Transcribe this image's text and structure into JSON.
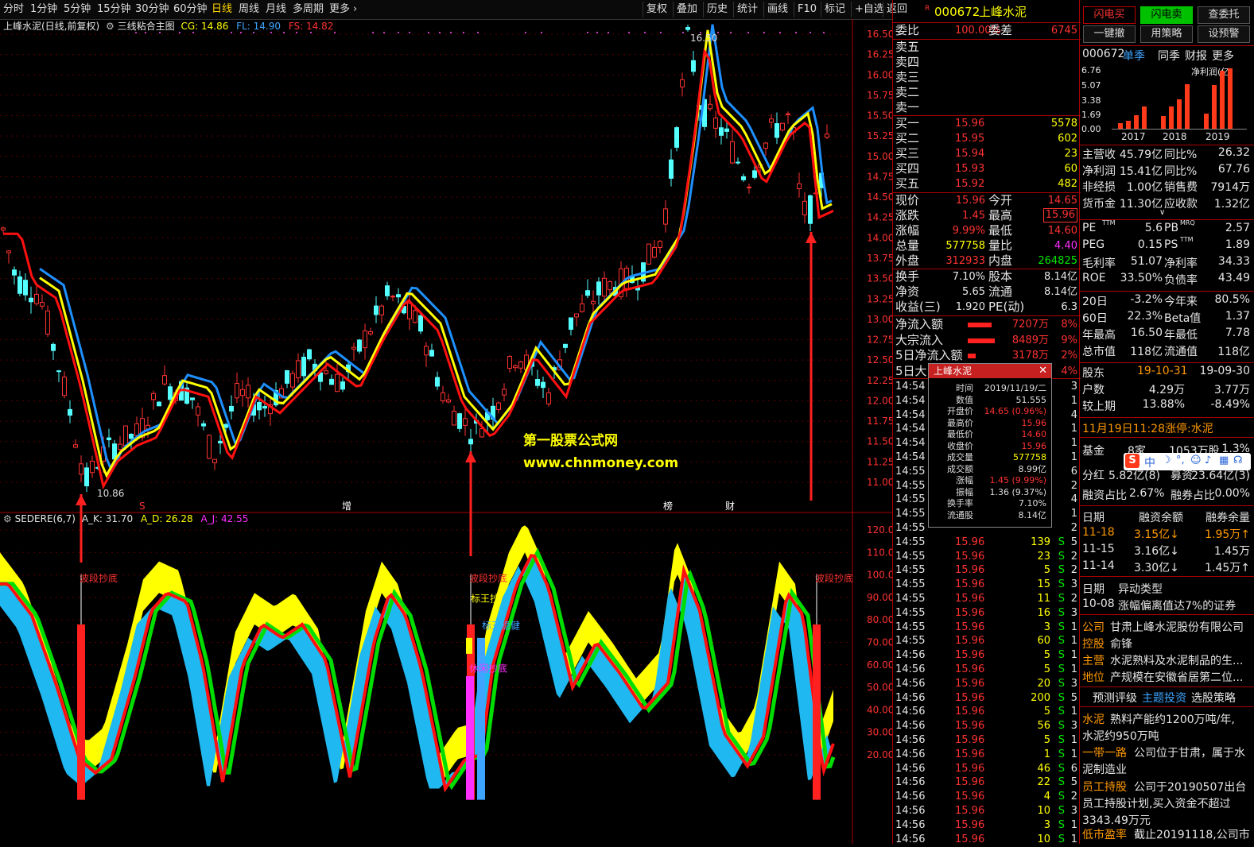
{
  "toolbar": {
    "periods": [
      "分时",
      "1分钟",
      "5分钟",
      "15分钟",
      "30分钟",
      "60分钟",
      "日线",
      "周线",
      "月线",
      "多周期",
      "更多"
    ],
    "active_period": "日线",
    "right_buttons": [
      "复权",
      "叠加",
      "历史",
      "统计",
      "画线",
      "F10",
      "标记",
      "+自选",
      "返回"
    ]
  },
  "main_legend": {
    "stock": "上峰水泥(日线,前复权)",
    "indicator": "三线粘合主图",
    "cg": "CG: 14.86",
    "fl": "FL: 14.90",
    "fs": "FS: 14.82"
  },
  "price_axis": [
    "16.50",
    "16.25",
    "16.00",
    "15.75",
    "15.50",
    "15.25",
    "15.00",
    "14.75",
    "14.50",
    "14.25",
    "14.00",
    "13.75",
    "13.50",
    "13.25",
    "13.00",
    "12.75",
    "12.50",
    "12.25",
    "12.00",
    "11.75",
    "11.50",
    "11.25",
    "11.00"
  ],
  "price_marks": {
    "high": "16.50",
    "low": "10.86"
  },
  "event_marks": [
    "S",
    "增",
    "榜",
    "财"
  ],
  "watermark": {
    "line1": "第一股票公式网",
    "line2": "www.chnmoney.com"
  },
  "sub_legend": {
    "name": "SEDERE(6,7)",
    "k": "A_K: 31.70",
    "d": "A_D: 26.28",
    "j": "A_J: 42.55"
  },
  "sub_axis": [
    "120.0",
    "110.0",
    "100.0",
    "90.00",
    "80.00",
    "70.00",
    "60.00",
    "50.00",
    "40.00",
    "30.00",
    "20.00"
  ],
  "sub_labels": {
    "bottom_buy": "波段抄底",
    "king": "标王抄",
    "king2": "标王稳健",
    "rest": "休闲抄底"
  },
  "quote": {
    "header_code": "000672",
    "header_name": "上峰水泥",
    "weibi_label": "委比",
    "weibi": "100.00%",
    "weicha_label": "委差",
    "weicha": "6745",
    "sells": [
      "卖五",
      "卖四",
      "卖三",
      "卖二",
      "卖一"
    ],
    "buys": [
      {
        "label": "买一",
        "price": "15.96",
        "vol": "5578"
      },
      {
        "label": "买二",
        "price": "15.95",
        "vol": "602"
      },
      {
        "label": "买三",
        "price": "15.94",
        "vol": "23"
      },
      {
        "label": "买四",
        "price": "15.93",
        "vol": "60"
      },
      {
        "label": "买五",
        "price": "15.92",
        "vol": "482"
      }
    ],
    "stats": [
      {
        "l1": "现价",
        "v1": "15.96",
        "l2": "今开",
        "v2": "14.65"
      },
      {
        "l1": "涨跌",
        "v1": "1.45",
        "l2": "最高",
        "v2": "15.96"
      },
      {
        "l1": "涨幅",
        "v1": "9.99%",
        "l2": "最低",
        "v2": "14.60"
      },
      {
        "l1": "总量",
        "v1": "577758",
        "l2": "量比",
        "v2": "4.40"
      },
      {
        "l1": "外盘",
        "v1": "312933",
        "l2": "内盘",
        "v2": "264825"
      }
    ],
    "stats2": [
      {
        "l1": "换手",
        "v1": "7.10%",
        "l2": "股本",
        "v2": "8.14亿"
      },
      {
        "l1": "净资",
        "v1": "5.65",
        "l2": "流通",
        "v2": "8.14亿"
      },
      {
        "l1": "收益(三)",
        "v1": "1.920",
        "l2": "PE(动)",
        "v2": "6.3"
      }
    ],
    "flows": [
      {
        "label": "净流入额",
        "value": "7207万",
        "pct": "8%"
      },
      {
        "label": "大宗流入",
        "value": "8489万",
        "pct": "9%"
      },
      {
        "label": "5日净流入额",
        "value": "3178万",
        "pct": "2%"
      },
      {
        "label": "5日大",
        "value": "",
        "pct": "4%"
      }
    ],
    "ticks": [
      {
        "t": "14:54",
        "p": "",
        "v": "",
        "s": "",
        "n": "3"
      },
      {
        "t": "14:54",
        "p": "",
        "v": "",
        "s": "",
        "n": "1"
      },
      {
        "t": "14:54",
        "p": "",
        "v": "",
        "s": "",
        "n": "4"
      },
      {
        "t": "14:54",
        "p": "",
        "v": "",
        "s": "",
        "n": "1"
      },
      {
        "t": "14:54",
        "p": "",
        "v": "",
        "s": "",
        "n": "1"
      },
      {
        "t": "14:54",
        "p": "",
        "v": "",
        "s": "",
        "n": "1"
      },
      {
        "t": "14:55",
        "p": "",
        "v": "",
        "s": "",
        "n": "6"
      },
      {
        "t": "14:55",
        "p": "",
        "v": "",
        "s": "",
        "n": "2"
      },
      {
        "t": "14:55",
        "p": "",
        "v": "",
        "s": "",
        "n": "4"
      },
      {
        "t": "14:55",
        "p": "",
        "v": "",
        "s": "",
        "n": "1"
      },
      {
        "t": "14:55",
        "p": "",
        "v": "",
        "s": "",
        "n": "2"
      },
      {
        "t": "14:55",
        "p": "15.96",
        "v": "139",
        "s": "S",
        "n": "5"
      },
      {
        "t": "14:55",
        "p": "15.96",
        "v": "23",
        "s": "S",
        "n": "2"
      },
      {
        "t": "14:55",
        "p": "15.96",
        "v": "5",
        "s": "S",
        "n": "2"
      },
      {
        "t": "14:55",
        "p": "15.96",
        "v": "15",
        "s": "S",
        "n": "3"
      },
      {
        "t": "14:55",
        "p": "15.96",
        "v": "11",
        "s": "S",
        "n": "2"
      },
      {
        "t": "14:55",
        "p": "15.96",
        "v": "16",
        "s": "S",
        "n": "3"
      },
      {
        "t": "14:55",
        "p": "15.96",
        "v": "3",
        "s": "S",
        "n": "1"
      },
      {
        "t": "14:55",
        "p": "15.96",
        "v": "60",
        "s": "S",
        "n": "1"
      },
      {
        "t": "14:56",
        "p": "15.96",
        "v": "5",
        "s": "S",
        "n": "1"
      },
      {
        "t": "14:56",
        "p": "15.96",
        "v": "5",
        "s": "S",
        "n": "1"
      },
      {
        "t": "14:56",
        "p": "15.96",
        "v": "20",
        "s": "S",
        "n": "3"
      },
      {
        "t": "14:56",
        "p": "15.96",
        "v": "200",
        "s": "S",
        "n": "5"
      },
      {
        "t": "14:56",
        "p": "15.96",
        "v": "5",
        "s": "S",
        "n": "1"
      },
      {
        "t": "14:56",
        "p": "15.96",
        "v": "56",
        "s": "S",
        "n": "3"
      },
      {
        "t": "14:56",
        "p": "15.96",
        "v": "5",
        "s": "S",
        "n": "1"
      },
      {
        "t": "14:56",
        "p": "15.96",
        "v": "1",
        "s": "S",
        "n": "1"
      },
      {
        "t": "14:56",
        "p": "15.96",
        "v": "46",
        "s": "S",
        "n": "6"
      },
      {
        "t": "14:56",
        "p": "15.96",
        "v": "22",
        "s": "S",
        "n": "5"
      },
      {
        "t": "14:56",
        "p": "15.96",
        "v": "4",
        "s": "S",
        "n": "2"
      },
      {
        "t": "14:56",
        "p": "15.96",
        "v": "10",
        "s": "S",
        "n": "3"
      },
      {
        "t": "14:56",
        "p": "15.96",
        "v": "3",
        "s": "S",
        "n": "1"
      },
      {
        "t": "14:56",
        "p": "15.96",
        "v": "10",
        "s": "S",
        "n": "1"
      }
    ]
  },
  "popup": {
    "title": "上峰水泥",
    "rows": [
      {
        "l": "时间",
        "v": "2019/11/19/二",
        "c": "#dddddd"
      },
      {
        "l": "数值",
        "v": "51.555",
        "c": "#dddddd"
      },
      {
        "l": "开盘价",
        "v": "14.65 (0.96%)",
        "c": "#ff3232"
      },
      {
        "l": "最高价",
        "v": "15.96",
        "c": "#ff3232"
      },
      {
        "l": "最低价",
        "v": "14.60",
        "c": "#ff3232"
      },
      {
        "l": "收盘价",
        "v": "15.96",
        "c": "#ff3232"
      },
      {
        "l": "成交量",
        "v": "577758",
        "c": "#ffff00"
      },
      {
        "l": "成交额",
        "v": "8.99亿",
        "c": "#dddddd"
      },
      {
        "l": "涨幅",
        "v": "1.45 (9.99%)",
        "c": "#ff3232"
      },
      {
        "l": "振幅",
        "v": "1.36 (9.37%)",
        "c": "#dddddd"
      },
      {
        "l": "换手率",
        "v": "7.10%",
        "c": "#dddddd"
      },
      {
        "l": "流通股",
        "v": "8.14亿",
        "c": "#dddddd"
      }
    ]
  },
  "f10": {
    "buttons": [
      "闪电买",
      "闪电卖",
      "查委托",
      "一键撤",
      "用策略",
      "设预警"
    ],
    "tabs_code": "000672",
    "tabs": [
      "单季",
      "同季",
      "财报",
      "更多"
    ],
    "bar_title": "净利润(亿)",
    "bar_yticks": [
      "6.76",
      "5.07",
      "3.38",
      "1.69",
      "0.00"
    ],
    "bar_years": [
      "2017",
      "2018",
      "2019"
    ],
    "bar_values": [
      0.6,
      0.9,
      1.5,
      2.5,
      1.4,
      2.5,
      3.3,
      5.0,
      1.7,
      4.9,
      6.5,
      6.76
    ],
    "metrics": [
      {
        "l1": "主营收",
        "v1": "45.79亿",
        "l2": "同比%",
        "v2": "26.32"
      },
      {
        "l1": "净利润",
        "v1": "15.41亿",
        "l2": "同比%",
        "v2": "67.76"
      },
      {
        "l1": "非经损",
        "v1": "1.00亿",
        "l2": "销售费",
        "v2": "7914万"
      },
      {
        "l1": "货币金",
        "v1": "11.30亿",
        "l2": "应收款",
        "v2": "1.32亿"
      }
    ],
    "valuation": [
      {
        "l1": "PE",
        "sup1": "TTM",
        "v1": "5.6",
        "l2": "PB",
        "sup2": "MRQ",
        "v2": "2.57"
      },
      {
        "l1": "PEG",
        "sup1": "",
        "v1": "0.15",
        "l2": "PS",
        "sup2": "TTM",
        "v2": "1.89"
      },
      {
        "l1": "毛利率",
        "sup1": "",
        "v1": "51.07",
        "l2": "净利率",
        "sup2": "",
        "v2": "34.33"
      },
      {
        "l1": "ROE",
        "sup1": "",
        "v1": "33.50%",
        "l2": "负债率",
        "sup2": "",
        "v2": "43.49"
      }
    ],
    "perf": [
      {
        "l1": "20日",
        "v1": "-3.2%",
        "l2": "今年来",
        "v2": "80.5%"
      },
      {
        "l1": "60日",
        "v1": "22.3%",
        "l2": "Beta值",
        "v2": "1.37"
      },
      {
        "l1": "年最高",
        "v1": "16.50",
        "l2": "年最低",
        "v2": "7.78"
      },
      {
        "l1": "总市值",
        "v1": "118亿",
        "l2": "流通值",
        "v2": "118亿"
      }
    ],
    "holders": {
      "label": "股东",
      "d1": "19-10-31",
      "d2": "19-09-30",
      "rows": [
        {
          "l": "户数",
          "v1": "4.29万",
          "v2": "3.77万"
        },
        {
          "l": "较上期",
          "v1": "13.88%",
          "v2": "-8.49%"
        }
      ]
    },
    "limit_note": "11月19日11:28涨停:水泥",
    "fund": {
      "label": "基金",
      "v1": "8家",
      "v2": "1053万股",
      "v3": "1.3%"
    },
    "dividend": {
      "label": "分红",
      "v1": "5.82亿(8)",
      "l2": "募资",
      "v2": "23.64亿(3)"
    },
    "margin_ratio": {
      "l1": "融资占比",
      "v1": "2.67%",
      "l2": "融券占比",
      "v2": "0.00%"
    },
    "margin": {
      "headers": [
        "日期",
        "融资余额",
        "融券余量"
      ],
      "rows": [
        {
          "d": "11-18",
          "v1": "3.15亿↓",
          "v2": "1.95万↑"
        },
        {
          "d": "11-15",
          "v1": "3.16亿↓",
          "v2": "1.45万"
        },
        {
          "d": "11-14",
          "v1": "3.30亿↓",
          "v2": "1.45万↑"
        }
      ]
    },
    "abn": {
      "h1": "日期",
      "h2": "异动类型",
      "d": "10-08",
      "t": "涨幅偏离值达7%的证券"
    },
    "company": [
      {
        "l": "公司",
        "v": "甘肃上峰水泥股份有限公司"
      },
      {
        "l": "控股",
        "v": "俞锋"
      },
      {
        "l": "主营",
        "v": "水泥熟料及水泥制品的生..."
      },
      {
        "l": "地位",
        "v": "产规模在安徽省居第二位..."
      }
    ],
    "bottom_tabs": [
      "预测评级",
      "主题投资",
      "选股策略"
    ],
    "themes": [
      {
        "tag": "水泥",
        "text": "熟料产能约1200万吨/年,",
        "text2": "水泥约950万吨"
      },
      {
        "tag": "一带一路",
        "text": "公司位于甘肃，属于水",
        "text2": "泥制造业"
      },
      {
        "tag": "员工持股",
        "text": "公司于20190507出台",
        "text2": "员工持股计划,买入资金不超过",
        "text3": "3343.49万元"
      },
      {
        "tag": "低市盈率",
        "text": "截止20191118,公司市",
        "text2": ""
      }
    ],
    "ime": "中"
  }
}
